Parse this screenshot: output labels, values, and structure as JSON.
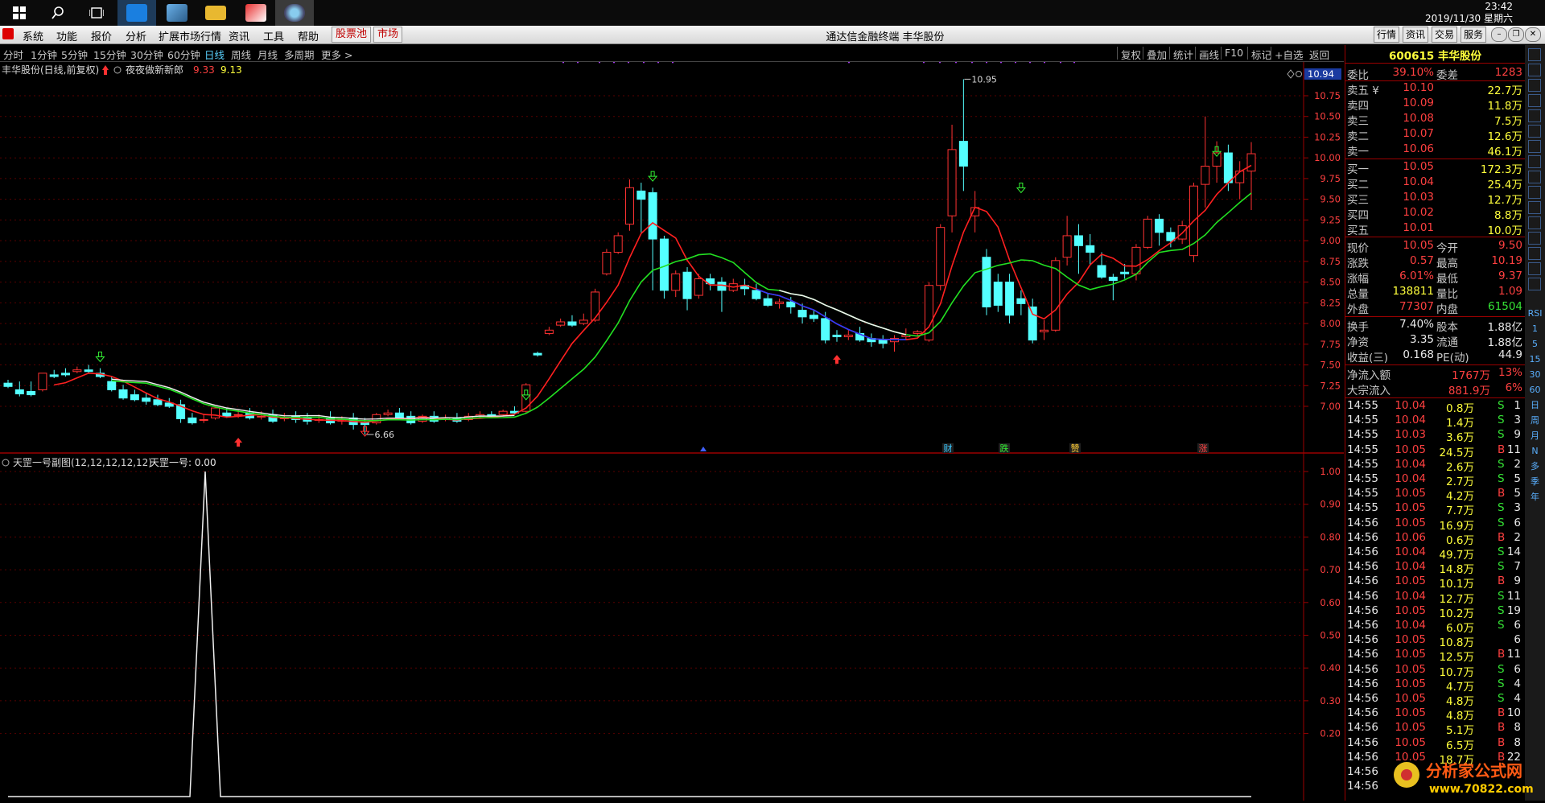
{
  "taskbar": {
    "time": "23:42",
    "date": "2019/11/30 星期六"
  },
  "menubar": {
    "items": [
      "系统",
      "功能",
      "报价",
      "分析",
      "扩展市场行情",
      "资讯",
      "工具",
      "帮助"
    ],
    "red_items": [
      "股票池",
      "市场"
    ],
    "title": "通达信金融终端  丰华股份",
    "right_buttons": [
      "行情",
      "资讯",
      "交易",
      "服务"
    ]
  },
  "periods": [
    "分时",
    "1分钟",
    "5分钟",
    "15分钟",
    "30分钟",
    "60分钟",
    "日线",
    "周线",
    "月线",
    "多周期",
    "更多 >"
  ],
  "active_period": "日线",
  "tools": [
    "复权",
    "叠加",
    "统计",
    "画线",
    "F10",
    "标记",
    "+自选",
    "返回"
  ],
  "chart": {
    "header_name": "丰华股份(日线,前复权)",
    "indicator_name": "夜夜做新新郎",
    "indicator_v1": "9.33",
    "indicator_v2": "9.13",
    "cursor_price": "10.94",
    "high_label": "10.95",
    "low_label": "6.66",
    "price_ticks": [
      "10.75",
      "10.50",
      "10.25",
      "10.00",
      "9.75",
      "9.50",
      "9.25",
      "9.00",
      "8.75",
      "8.50",
      "8.25",
      "8.00",
      "7.75",
      "7.50",
      "7.25",
      "7.00"
    ],
    "event_markers": [
      "财",
      "跌",
      "赞",
      "涨"
    ],
    "sub_header": "天罡一号副图(12,12,12,12,12)",
    "sub_value_label": "天罡一号: 0.00",
    "sub_ticks": [
      "1.00",
      "0.90",
      "0.80",
      "0.70",
      "0.60",
      "0.50",
      "0.40",
      "0.30",
      "0.20"
    ]
  },
  "chart_data": {
    "type": "candlestick",
    "title": "丰华股份(日线,前复权)",
    "ylim": [
      6.6,
      11.0
    ],
    "candles": [
      [
        7.28,
        7.32,
        7.24,
        7.22
      ],
      [
        7.2,
        7.3,
        7.15,
        7.12
      ],
      [
        7.18,
        7.3,
        7.14,
        7.12
      ],
      [
        7.2,
        7.36,
        7.4,
        7.18
      ],
      [
        7.38,
        7.44,
        7.36,
        7.34
      ],
      [
        7.4,
        7.46,
        7.38,
        7.36
      ],
      [
        7.42,
        7.48,
        7.44,
        7.4
      ],
      [
        7.44,
        7.5,
        7.42,
        7.4
      ],
      [
        7.4,
        7.46,
        7.36,
        7.34
      ],
      [
        7.3,
        7.36,
        7.2,
        7.18
      ],
      [
        7.2,
        7.26,
        7.1,
        7.08
      ],
      [
        7.14,
        7.2,
        7.08,
        7.06
      ],
      [
        7.1,
        7.16,
        7.06,
        7.02
      ],
      [
        7.08,
        7.14,
        7.02,
        7.0
      ],
      [
        7.04,
        7.1,
        7.0,
        6.98
      ],
      [
        7.02,
        7.08,
        6.85,
        6.8
      ],
      [
        6.86,
        6.92,
        6.8,
        6.78
      ],
      [
        6.84,
        6.9,
        6.84,
        6.8
      ],
      [
        6.86,
        6.96,
        6.98,
        6.84
      ],
      [
        6.92,
        6.98,
        6.88,
        6.86
      ],
      [
        6.9,
        6.96,
        6.9,
        6.86
      ],
      [
        6.92,
        6.98,
        6.86,
        6.84
      ],
      [
        6.88,
        6.94,
        6.88,
        6.84
      ],
      [
        6.9,
        6.96,
        6.82,
        6.8
      ],
      [
        6.86,
        6.92,
        6.86,
        6.82
      ],
      [
        6.88,
        6.94,
        6.84,
        6.8
      ],
      [
        6.86,
        6.92,
        6.82,
        6.78
      ],
      [
        6.84,
        6.9,
        6.84,
        6.8
      ],
      [
        6.86,
        6.94,
        6.8,
        6.78
      ],
      [
        6.82,
        6.88,
        6.84,
        6.78
      ],
      [
        6.86,
        6.92,
        6.78,
        6.72
      ],
      [
        6.8,
        6.86,
        6.78,
        6.66
      ],
      [
        6.8,
        6.92,
        6.9,
        6.78
      ],
      [
        6.9,
        6.96,
        6.92,
        6.88
      ],
      [
        6.92,
        6.98,
        6.86,
        6.84
      ],
      [
        6.88,
        6.94,
        6.8,
        6.78
      ],
      [
        6.82,
        6.9,
        6.88,
        6.8
      ],
      [
        6.88,
        6.94,
        6.82,
        6.8
      ],
      [
        6.84,
        6.9,
        6.86,
        6.82
      ],
      [
        6.86,
        6.92,
        6.82,
        6.8
      ],
      [
        6.84,
        6.92,
        6.88,
        6.82
      ],
      [
        6.88,
        6.94,
        6.9,
        6.86
      ],
      [
        6.9,
        6.94,
        6.88,
        6.86
      ],
      [
        6.9,
        6.96,
        6.94,
        6.88
      ],
      [
        6.94,
        7.0,
        6.92,
        6.9
      ],
      [
        6.94,
        7.28,
        7.26,
        6.92
      ],
      [
        7.64,
        7.66,
        7.62,
        7.6
      ],
      [
        7.88,
        7.96,
        7.92,
        7.86
      ],
      [
        7.98,
        8.06,
        8.02,
        7.96
      ],
      [
        8.02,
        8.1,
        7.98,
        7.96
      ],
      [
        8.0,
        8.12,
        8.04,
        7.98
      ],
      [
        8.04,
        8.42,
        8.38,
        8.02
      ],
      [
        8.6,
        8.9,
        8.86,
        8.58
      ],
      [
        8.86,
        9.1,
        9.06,
        8.84
      ],
      [
        9.2,
        9.74,
        9.64,
        9.12
      ],
      [
        9.6,
        9.7,
        9.5,
        9.1
      ],
      [
        9.58,
        9.64,
        9.02,
        8.4
      ],
      [
        9.02,
        9.06,
        8.4,
        8.3
      ],
      [
        8.4,
        8.64,
        8.6,
        8.32
      ],
      [
        8.62,
        8.68,
        8.3,
        8.16
      ],
      [
        8.34,
        8.6,
        8.54,
        8.3
      ],
      [
        8.54,
        8.6,
        8.48,
        8.4
      ],
      [
        8.5,
        8.56,
        8.4,
        8.14
      ],
      [
        8.4,
        8.54,
        8.48,
        8.38
      ],
      [
        8.46,
        8.54,
        8.42,
        8.34
      ],
      [
        8.4,
        8.48,
        8.3,
        8.28
      ],
      [
        8.3,
        8.36,
        8.22,
        8.2
      ],
      [
        8.24,
        8.3,
        8.26,
        8.18
      ],
      [
        8.26,
        8.32,
        8.2,
        8.12
      ],
      [
        8.16,
        8.24,
        8.08,
        8.0
      ],
      [
        8.1,
        8.16,
        8.06,
        8.02
      ],
      [
        8.06,
        8.14,
        7.8,
        7.76
      ],
      [
        7.86,
        7.92,
        7.84,
        7.78
      ],
      [
        7.84,
        7.92,
        7.86,
        7.8
      ],
      [
        7.88,
        7.96,
        7.8,
        7.78
      ],
      [
        7.82,
        7.88,
        7.78,
        7.72
      ],
      [
        7.8,
        7.86,
        7.76,
        7.7
      ],
      [
        7.78,
        7.86,
        7.82,
        7.66
      ],
      [
        7.84,
        7.94,
        7.86,
        7.8
      ],
      [
        7.88,
        7.92,
        7.9,
        7.84
      ],
      [
        7.8,
        8.5,
        8.46,
        7.78
      ],
      [
        8.46,
        9.2,
        9.16,
        8.4
      ],
      [
        9.3,
        10.4,
        10.1,
        9.1
      ],
      [
        10.2,
        10.95,
        9.9,
        9.6
      ],
      [
        9.3,
        9.6,
        9.4,
        9.1
      ],
      [
        8.8,
        8.9,
        8.2,
        8.1
      ],
      [
        8.5,
        8.6,
        8.22,
        8.14
      ],
      [
        8.5,
        8.6,
        8.1,
        8.0
      ],
      [
        8.3,
        8.4,
        8.24,
        8.1
      ],
      [
        8.2,
        8.3,
        7.8,
        7.76
      ],
      [
        7.9,
        8.04,
        7.92,
        7.8
      ],
      [
        7.92,
        8.8,
        8.76,
        7.9
      ],
      [
        8.8,
        9.3,
        9.06,
        8.7
      ],
      [
        9.06,
        9.2,
        8.94,
        8.6
      ],
      [
        8.94,
        9.08,
        8.86,
        8.7
      ],
      [
        8.7,
        8.86,
        8.56,
        8.54
      ],
      [
        8.56,
        8.6,
        8.52,
        8.28
      ],
      [
        8.62,
        8.72,
        8.6,
        8.54
      ],
      [
        8.6,
        8.96,
        8.92,
        8.52
      ],
      [
        8.92,
        9.3,
        9.26,
        8.9
      ],
      [
        9.26,
        9.32,
        9.1,
        8.94
      ],
      [
        9.1,
        9.16,
        9.0,
        8.92
      ],
      [
        9.02,
        9.24,
        9.18,
        8.96
      ],
      [
        8.82,
        9.7,
        9.66,
        8.74
      ],
      [
        9.68,
        10.5,
        9.9,
        9.4
      ],
      [
        9.9,
        10.2,
        10.06,
        9.7
      ],
      [
        10.06,
        10.16,
        9.7,
        9.6
      ],
      [
        9.7,
        9.96,
        9.84,
        9.5
      ],
      [
        9.84,
        10.19,
        10.05,
        9.37
      ]
    ],
    "ma_fast": [],
    "sub_series": []
  },
  "quote": {
    "code_name": "600615 丰华股份",
    "weibi_label": "委比",
    "weibi": "39.10%",
    "weicha_label": "委差",
    "weicha": "1283",
    "asks": [
      {
        "label": "卖五 ¥",
        "price": "10.10",
        "vol": "22.7万"
      },
      {
        "label": "卖四",
        "price": "10.09",
        "vol": "11.8万"
      },
      {
        "label": "卖三",
        "price": "10.08",
        "vol": "7.5万"
      },
      {
        "label": "卖二",
        "price": "10.07",
        "vol": "12.6万"
      },
      {
        "label": "卖一",
        "price": "10.06",
        "vol": "46.1万"
      }
    ],
    "bids": [
      {
        "label": "买一",
        "price": "10.05",
        "vol": "172.3万"
      },
      {
        "label": "买二",
        "price": "10.04",
        "vol": "25.4万"
      },
      {
        "label": "买三",
        "price": "10.03",
        "vol": "12.7万"
      },
      {
        "label": "买四",
        "price": "10.02",
        "vol": "8.8万"
      },
      {
        "label": "买五",
        "price": "10.01",
        "vol": "10.0万"
      }
    ],
    "stats": [
      {
        "l1": "现价",
        "v1": "10.05",
        "c1": "red",
        "l2": "今开",
        "v2": "9.50",
        "c2": "red"
      },
      {
        "l1": "涨跌",
        "v1": "0.57",
        "c1": "red",
        "l2": "最高",
        "v2": "10.19",
        "c2": "red"
      },
      {
        "l1": "涨幅",
        "v1": "6.01%",
        "c1": "red",
        "l2": "最低",
        "v2": "9.37",
        "c2": "red"
      },
      {
        "l1": "总量",
        "v1": "138811",
        "c1": "yel",
        "l2": "量比",
        "v2": "1.09",
        "c2": "red"
      },
      {
        "l1": "外盘",
        "v1": "77307",
        "c1": "red",
        "l2": "内盘",
        "v2": "61504",
        "c2": "grn"
      }
    ],
    "stats2": [
      {
        "l1": "换手",
        "v1": "7.40%",
        "l2": "股本",
        "v2": "1.88亿"
      },
      {
        "l1": "净资",
        "v1": "3.35",
        "l2": "流通",
        "v2": "1.88亿"
      },
      {
        "l1": "收益(三)",
        "v1": "0.168",
        "l2": "PE(动)",
        "v2": "44.9"
      }
    ],
    "flow": [
      {
        "label": "净流入额",
        "v1": "1767万",
        "v2": "13%"
      },
      {
        "label": "大宗流入",
        "v1": "881.9万",
        "v2": "6%"
      }
    ]
  },
  "ticks": [
    [
      "14:55",
      "10.04",
      "0.8万",
      "S",
      "1"
    ],
    [
      "14:55",
      "10.04",
      "1.4万",
      "S",
      "3"
    ],
    [
      "14:55",
      "10.03",
      "3.6万",
      "S",
      "9"
    ],
    [
      "14:55",
      "10.05",
      "24.5万",
      "B",
      "11"
    ],
    [
      "14:55",
      "10.04",
      "2.6万",
      "S",
      "2"
    ],
    [
      "14:55",
      "10.04",
      "2.7万",
      "S",
      "5"
    ],
    [
      "14:55",
      "10.05",
      "4.2万",
      "B",
      "5"
    ],
    [
      "14:55",
      "10.05",
      "7.7万",
      "S",
      "3"
    ],
    [
      "14:56",
      "10.05",
      "16.9万",
      "S",
      "6"
    ],
    [
      "14:56",
      "10.06",
      "0.6万",
      "B",
      "2"
    ],
    [
      "14:56",
      "10.04",
      "49.7万",
      "S",
      "14"
    ],
    [
      "14:56",
      "10.04",
      "14.8万",
      "S",
      "7"
    ],
    [
      "14:56",
      "10.05",
      "10.1万",
      "B",
      "9"
    ],
    [
      "14:56",
      "10.04",
      "12.7万",
      "S",
      "11"
    ],
    [
      "14:56",
      "10.05",
      "10.2万",
      "S",
      "19"
    ],
    [
      "14:56",
      "10.04",
      "6.0万",
      "S",
      "6"
    ],
    [
      "14:56",
      "10.05",
      "10.8万",
      "",
      "6"
    ],
    [
      "14:56",
      "10.05",
      "12.5万",
      "B",
      "11"
    ],
    [
      "14:56",
      "10.05",
      "10.7万",
      "S",
      "6"
    ],
    [
      "14:56",
      "10.05",
      "4.7万",
      "S",
      "4"
    ],
    [
      "14:56",
      "10.05",
      "4.8万",
      "S",
      "4"
    ],
    [
      "14:56",
      "10.05",
      "4.8万",
      "B",
      "10"
    ],
    [
      "14:56",
      "10.05",
      "5.1万",
      "B",
      "8"
    ],
    [
      "14:56",
      "10.05",
      "6.5万",
      "B",
      "8"
    ],
    [
      "14:56",
      "10.05",
      "18.7万",
      "B",
      "22"
    ],
    [
      "14:56",
      "",
      "",
      "",
      ""
    ],
    [
      "14:56",
      "",
      "",
      "",
      ""
    ]
  ],
  "sidebar_labels": [
    "RSI",
    "1",
    "5",
    "15",
    "30",
    "60",
    "日",
    "周",
    "月",
    "N",
    "多",
    "季",
    "年"
  ],
  "watermark": {
    "line1": "分析家公式网",
    "line2": "www.70822.com"
  }
}
